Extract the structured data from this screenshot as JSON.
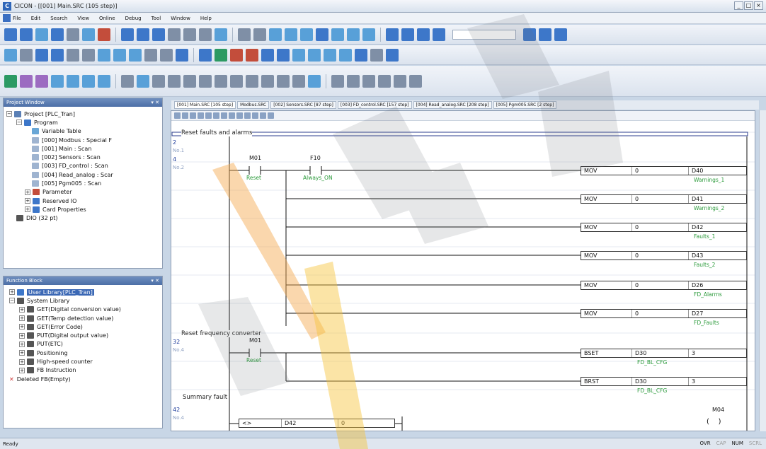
{
  "window": {
    "title": "CICON - [[001] Main.SRC (105 step)]"
  },
  "menu": [
    "File",
    "Edit",
    "Search",
    "View",
    "Online",
    "Debug",
    "Tool",
    "Window",
    "Help"
  ],
  "project_panel": {
    "title": "Project Window",
    "items": [
      {
        "label": "Project [PLC_Tran]",
        "level": 0
      },
      {
        "label": "Program",
        "level": 1
      },
      {
        "label": "Variable Table",
        "level": 2
      },
      {
        "label": "[000] Modbus : Special F",
        "level": 2
      },
      {
        "label": "[001] Main : Scan",
        "level": 2
      },
      {
        "label": "[002] Sensors : Scan",
        "level": 2
      },
      {
        "label": "[003] FD_control : Scan",
        "level": 2
      },
      {
        "label": "[004] Read_analog : Scar",
        "level": 2
      },
      {
        "label": "[005] Pgm005 : Scan",
        "level": 2
      },
      {
        "label": "Parameter",
        "level": 1
      },
      {
        "label": "Reserved IO",
        "level": 1
      },
      {
        "label": "Card Properties",
        "level": 1
      },
      {
        "label": "DIO (32 pt)",
        "level": 0
      }
    ]
  },
  "function_panel": {
    "title": "Function Block",
    "items": [
      {
        "label": "User Library[PLC_Tran]",
        "level": 0
      },
      {
        "label": "System Library",
        "level": 0
      },
      {
        "label": "GET(Digital conversion value)",
        "level": 1
      },
      {
        "label": "GET(Temp detection value)",
        "level": 1
      },
      {
        "label": "GET(Error Code)",
        "level": 1
      },
      {
        "label": "PUT(Digital output value)",
        "level": 1
      },
      {
        "label": "PUT(ETC)",
        "level": 1
      },
      {
        "label": "Positioning",
        "level": 1
      },
      {
        "label": "High-speed counter",
        "level": 1
      },
      {
        "label": "FB Instruction",
        "level": 1
      },
      {
        "label": "Deleted FB(Empty)",
        "level": 0
      }
    ]
  },
  "tabs": [
    "[001] Main.SRC [105 step]",
    "Modbus.SRC",
    "[002] Sensors.SRC [87 step]",
    "[003] FD_control.SRC [157 step]",
    "[004] Read_analog.SRC [208 step]",
    "[005] Pgm005.SRC [2 step]"
  ],
  "ladder": {
    "comment1": "Reset faults and alarms",
    "step2": "2",
    "step2sub": "No.1",
    "step4": "4",
    "step4sub": "No.2",
    "c1": {
      "name": "M01",
      "label": "Reset"
    },
    "c2": {
      "name": "F10",
      "label": "Always_ON"
    },
    "ops": [
      {
        "op": "MOV",
        "src": "0",
        "dst": "D40",
        "label": "Warnings_1"
      },
      {
        "op": "MOV",
        "src": "0",
        "dst": "D41",
        "label": "Warnings_2"
      },
      {
        "op": "MOV",
        "src": "0",
        "dst": "D42",
        "label": "Faults_1"
      },
      {
        "op": "MOV",
        "src": "0",
        "dst": "D43",
        "label": "Faults_2"
      },
      {
        "op": "MOV",
        "src": "0",
        "dst": "D26",
        "label": "FD_Alarms"
      },
      {
        "op": "MOV",
        "src": "0",
        "dst": "D27",
        "label": "FD_Faults"
      }
    ],
    "comment2": "Reset frequency converter",
    "step32": "32",
    "step32sub": "No.4",
    "c3": {
      "name": "M01",
      "label": "Reset"
    },
    "ops2": [
      {
        "op": "BSET",
        "src": "D30",
        "dst": "3",
        "label": "FD_BL_CFG"
      },
      {
        "op": "BRST",
        "src": "D30",
        "dst": "3",
        "label": "FD_BL_CFG"
      }
    ],
    "comment3": "Summary fault",
    "step42": "42",
    "step42sub": "No.4",
    "cmp": {
      "op": "<>",
      "a": "D42",
      "b": "0"
    },
    "coil": "M04"
  },
  "status": {
    "left": "Ready",
    "right": [
      "OVR",
      "CAP",
      "NUM",
      "SCRL"
    ]
  }
}
